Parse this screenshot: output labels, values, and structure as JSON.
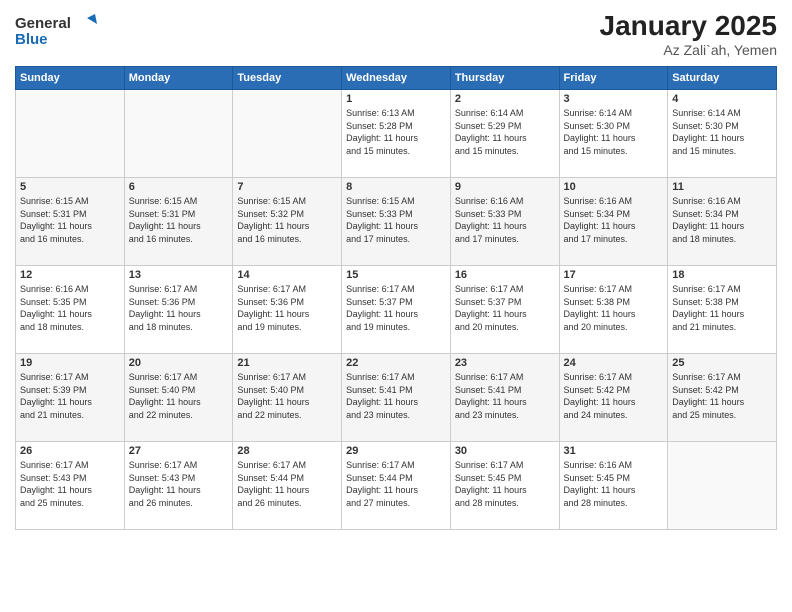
{
  "logo": {
    "general": "General",
    "blue": "Blue"
  },
  "title": "January 2025",
  "location": "Az Zali`ah, Yemen",
  "days_of_week": [
    "Sunday",
    "Monday",
    "Tuesday",
    "Wednesday",
    "Thursday",
    "Friday",
    "Saturday"
  ],
  "weeks": [
    [
      {
        "day": "",
        "info": ""
      },
      {
        "day": "",
        "info": ""
      },
      {
        "day": "",
        "info": ""
      },
      {
        "day": "1",
        "info": "Sunrise: 6:13 AM\nSunset: 5:28 PM\nDaylight: 11 hours\nand 15 minutes."
      },
      {
        "day": "2",
        "info": "Sunrise: 6:14 AM\nSunset: 5:29 PM\nDaylight: 11 hours\nand 15 minutes."
      },
      {
        "day": "3",
        "info": "Sunrise: 6:14 AM\nSunset: 5:30 PM\nDaylight: 11 hours\nand 15 minutes."
      },
      {
        "day": "4",
        "info": "Sunrise: 6:14 AM\nSunset: 5:30 PM\nDaylight: 11 hours\nand 15 minutes."
      }
    ],
    [
      {
        "day": "5",
        "info": "Sunrise: 6:15 AM\nSunset: 5:31 PM\nDaylight: 11 hours\nand 16 minutes."
      },
      {
        "day": "6",
        "info": "Sunrise: 6:15 AM\nSunset: 5:31 PM\nDaylight: 11 hours\nand 16 minutes."
      },
      {
        "day": "7",
        "info": "Sunrise: 6:15 AM\nSunset: 5:32 PM\nDaylight: 11 hours\nand 16 minutes."
      },
      {
        "day": "8",
        "info": "Sunrise: 6:15 AM\nSunset: 5:33 PM\nDaylight: 11 hours\nand 17 minutes."
      },
      {
        "day": "9",
        "info": "Sunrise: 6:16 AM\nSunset: 5:33 PM\nDaylight: 11 hours\nand 17 minutes."
      },
      {
        "day": "10",
        "info": "Sunrise: 6:16 AM\nSunset: 5:34 PM\nDaylight: 11 hours\nand 17 minutes."
      },
      {
        "day": "11",
        "info": "Sunrise: 6:16 AM\nSunset: 5:34 PM\nDaylight: 11 hours\nand 18 minutes."
      }
    ],
    [
      {
        "day": "12",
        "info": "Sunrise: 6:16 AM\nSunset: 5:35 PM\nDaylight: 11 hours\nand 18 minutes."
      },
      {
        "day": "13",
        "info": "Sunrise: 6:17 AM\nSunset: 5:36 PM\nDaylight: 11 hours\nand 18 minutes."
      },
      {
        "day": "14",
        "info": "Sunrise: 6:17 AM\nSunset: 5:36 PM\nDaylight: 11 hours\nand 19 minutes."
      },
      {
        "day": "15",
        "info": "Sunrise: 6:17 AM\nSunset: 5:37 PM\nDaylight: 11 hours\nand 19 minutes."
      },
      {
        "day": "16",
        "info": "Sunrise: 6:17 AM\nSunset: 5:37 PM\nDaylight: 11 hours\nand 20 minutes."
      },
      {
        "day": "17",
        "info": "Sunrise: 6:17 AM\nSunset: 5:38 PM\nDaylight: 11 hours\nand 20 minutes."
      },
      {
        "day": "18",
        "info": "Sunrise: 6:17 AM\nSunset: 5:38 PM\nDaylight: 11 hours\nand 21 minutes."
      }
    ],
    [
      {
        "day": "19",
        "info": "Sunrise: 6:17 AM\nSunset: 5:39 PM\nDaylight: 11 hours\nand 21 minutes."
      },
      {
        "day": "20",
        "info": "Sunrise: 6:17 AM\nSunset: 5:40 PM\nDaylight: 11 hours\nand 22 minutes."
      },
      {
        "day": "21",
        "info": "Sunrise: 6:17 AM\nSunset: 5:40 PM\nDaylight: 11 hours\nand 22 minutes."
      },
      {
        "day": "22",
        "info": "Sunrise: 6:17 AM\nSunset: 5:41 PM\nDaylight: 11 hours\nand 23 minutes."
      },
      {
        "day": "23",
        "info": "Sunrise: 6:17 AM\nSunset: 5:41 PM\nDaylight: 11 hours\nand 23 minutes."
      },
      {
        "day": "24",
        "info": "Sunrise: 6:17 AM\nSunset: 5:42 PM\nDaylight: 11 hours\nand 24 minutes."
      },
      {
        "day": "25",
        "info": "Sunrise: 6:17 AM\nSunset: 5:42 PM\nDaylight: 11 hours\nand 25 minutes."
      }
    ],
    [
      {
        "day": "26",
        "info": "Sunrise: 6:17 AM\nSunset: 5:43 PM\nDaylight: 11 hours\nand 25 minutes."
      },
      {
        "day": "27",
        "info": "Sunrise: 6:17 AM\nSunset: 5:43 PM\nDaylight: 11 hours\nand 26 minutes."
      },
      {
        "day": "28",
        "info": "Sunrise: 6:17 AM\nSunset: 5:44 PM\nDaylight: 11 hours\nand 26 minutes."
      },
      {
        "day": "29",
        "info": "Sunrise: 6:17 AM\nSunset: 5:44 PM\nDaylight: 11 hours\nand 27 minutes."
      },
      {
        "day": "30",
        "info": "Sunrise: 6:17 AM\nSunset: 5:45 PM\nDaylight: 11 hours\nand 28 minutes."
      },
      {
        "day": "31",
        "info": "Sunrise: 6:16 AM\nSunset: 5:45 PM\nDaylight: 11 hours\nand 28 minutes."
      },
      {
        "day": "",
        "info": ""
      }
    ]
  ]
}
